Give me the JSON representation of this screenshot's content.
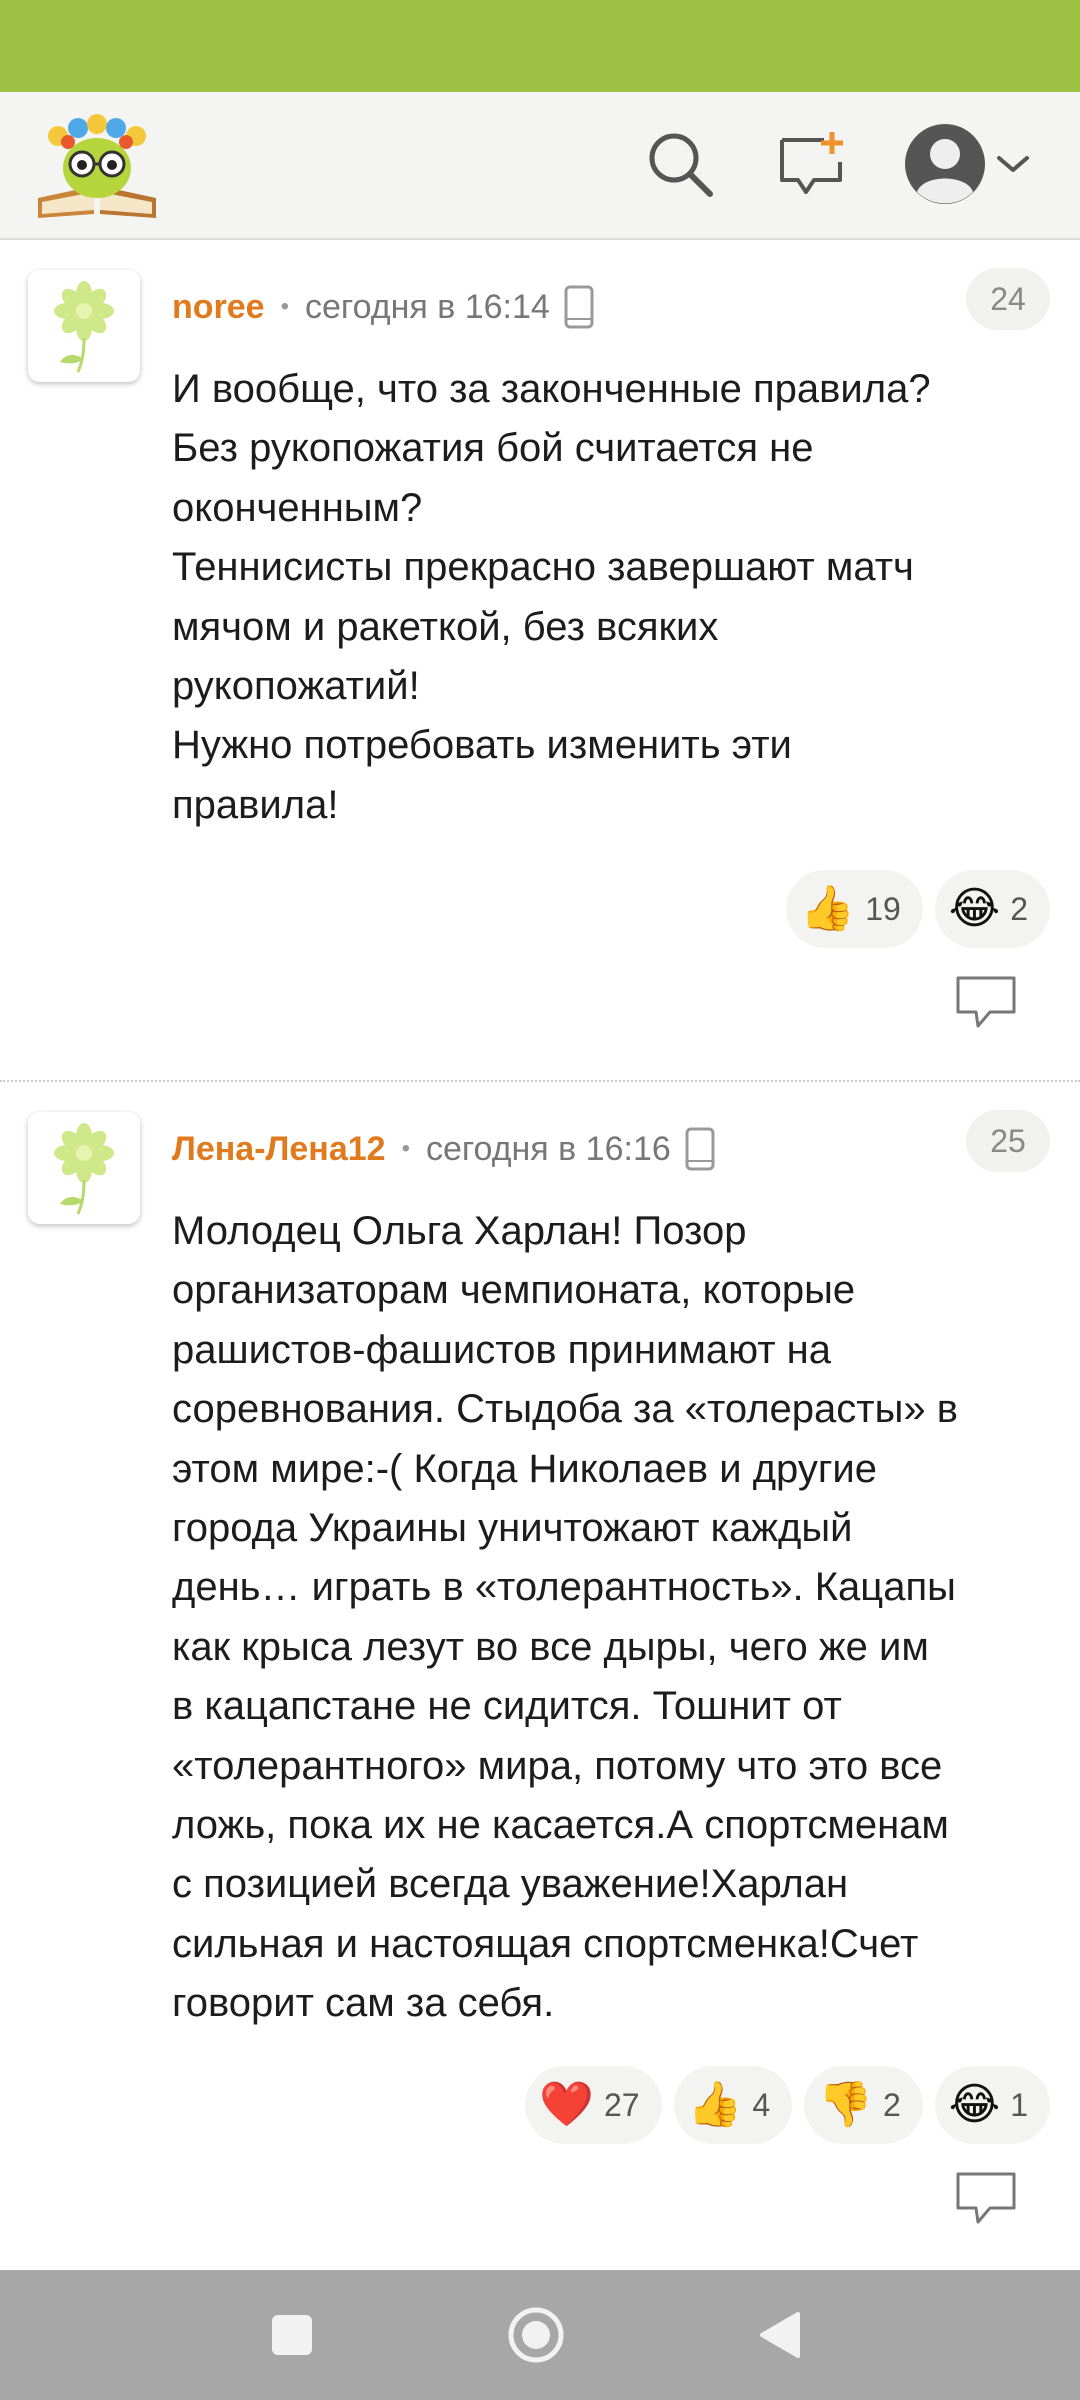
{
  "comments": [
    {
      "author": "noree",
      "time": "сегодня в 16:14",
      "number": "24",
      "text": "И вообще, что за законченные правила?\nБез рукопожатия бой считается не\nоконченным?\nТеннисисты прекрасно завершают матч\nмячом и ракеткой, без всяких\nрукопожатий!\nНужно потребовать изменить эти\nправила!",
      "reactions": [
        {
          "icon": "thumbs-up",
          "emoji": "👍",
          "count": "19"
        },
        {
          "icon": "laughing-tears",
          "emoji": "😂",
          "count": "2"
        }
      ]
    },
    {
      "author": "Лена-Лена12",
      "time": "сегодня в 16:16",
      "number": "25",
      "text": "Молодец Ольга Харлан! Позор\nорганизаторам чемпионата, которые\nрашистов-фашистов принимают на\nсоревнования. Стыдоба за «толерасты» в\nэтом мире:-( Когда Николаев и другие\nгорода Украины уничтожают каждый\nдень… играть в «толерантность». Кацапы\nкак крыса лезут во все дыры, чего же им\nв кацапстане не сидится. Тошнит от\n«толерантного» мира, потому что это все\nложь, пока их не касается.А спортсменам\nс позицией всегда уважение!Харлан\nсильная и настоящая спортсменка!Счет\nговорит сам за себя.",
      "reactions": [
        {
          "icon": "heart",
          "emoji": "❤️",
          "count": "27"
        },
        {
          "icon": "thumbs-up",
          "emoji": "👍",
          "count": "4"
        },
        {
          "icon": "thumbs-down",
          "emoji": "👎",
          "count": "2"
        },
        {
          "icon": "laughing-tears",
          "emoji": "😂",
          "count": "1"
        }
      ]
    }
  ],
  "colors": {
    "status_bar": "#9dc142",
    "author": "#e07a1c",
    "nav_bar": "#a7a7a7"
  }
}
